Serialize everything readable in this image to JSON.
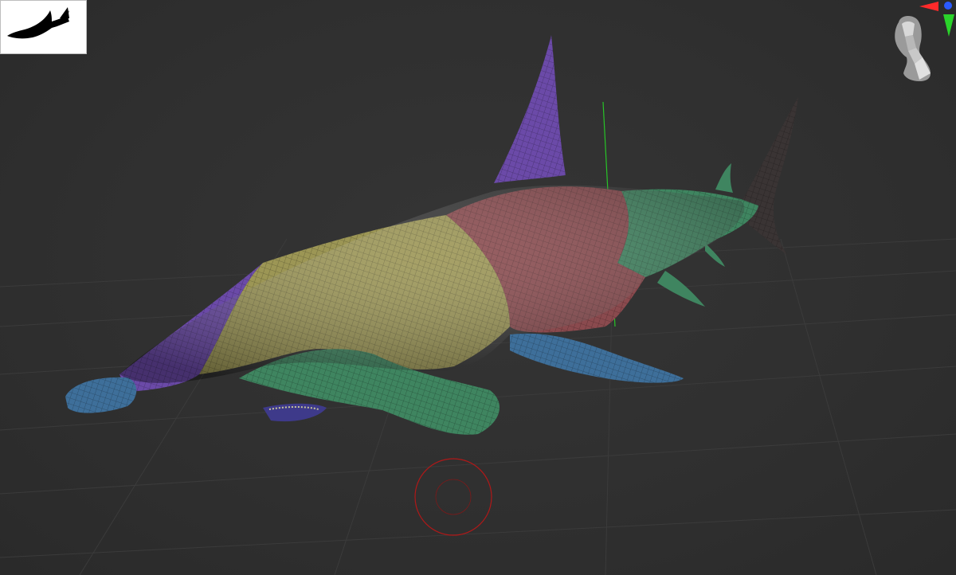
{
  "app": {
    "view": "3d-viewport"
  },
  "thumbnail": {
    "icon": "hammerhead-shark-silhouette",
    "background": "#ffffff",
    "fill": "#000000"
  },
  "navigation_gizmo": {
    "icon": "head-bust",
    "axes": [
      {
        "axis": "x",
        "color": "#ff2a2a"
      },
      {
        "axis": "y",
        "color": "#2ad42a"
      },
      {
        "axis": "z",
        "color": "#2a5aff"
      }
    ]
  },
  "model": {
    "name": "hammerhead-shark",
    "polygroup_colors": {
      "purple": "#6b4aa8",
      "yellow": "#9c9655",
      "red": "#8a4a4e",
      "green": "#3f8560",
      "blue": "#3e6f9a",
      "dark": "#3a3434"
    }
  },
  "floor_grid": {
    "visible": true,
    "color": "#3c3c3c"
  },
  "gizmo": {
    "transpose_ring_color": "#b01818",
    "pivot_line_color": "#27c427"
  }
}
